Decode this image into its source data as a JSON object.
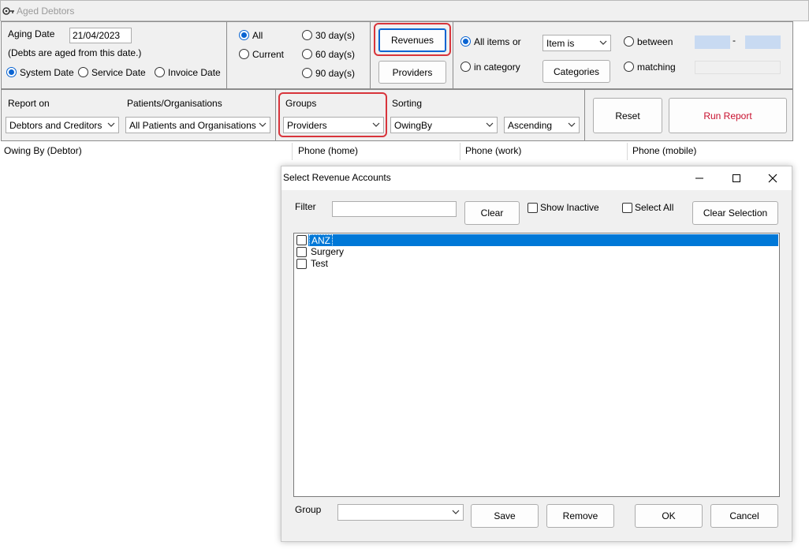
{
  "window": {
    "title": "Aged Debtors"
  },
  "aging": {
    "label": "Aging Date",
    "date": "21/04/2023",
    "note": "(Debts are aged from this date.)",
    "date_modes": [
      "System Date",
      "Service Date",
      "Invoice Date"
    ],
    "selected_mode": "System Date"
  },
  "period": {
    "options": [
      "All",
      "Current",
      "30 day(s)",
      "60 day(s)",
      "90 day(s)"
    ],
    "selected": "All"
  },
  "buttons": {
    "revenues": "Revenues",
    "providers": "Providers",
    "categories": "Categories",
    "reset": "Reset",
    "run_report": "Run Report"
  },
  "items": {
    "all_items": "All items",
    "or": "or",
    "in_category": "in category",
    "item_is": "Item is",
    "between": "between",
    "dash": "-",
    "matching": "matching"
  },
  "report": {
    "report_on_label": "Report on",
    "report_on_value": "Debtors and Creditors",
    "patients_label": "Patients/Organisations",
    "patients_value": "All Patients and Organisations",
    "groups_label": "Groups",
    "groups_value": "Providers",
    "sorting_label": "Sorting",
    "sorting_value": "OwingBy",
    "order_value": "Ascending"
  },
  "table": {
    "columns": [
      "Owing By (Debtor)",
      "Phone (home)",
      "Phone (work)",
      "Phone (mobile)"
    ]
  },
  "dialog": {
    "title": "Select Revenue Accounts",
    "filter_label": "Filter",
    "filter_value": "",
    "clear": "Clear",
    "show_inactive": "Show Inactive",
    "select_all": "Select All",
    "clear_selection": "Clear Selection",
    "accounts": [
      "ANZ",
      "Surgery",
      "Test"
    ],
    "selected_account": "ANZ",
    "group_label": "Group",
    "group_value": "",
    "save": "Save",
    "remove": "Remove",
    "ok": "OK",
    "cancel": "Cancel"
  },
  "colors": {
    "accent": "#0a64d2",
    "highlight": "#d8343b",
    "selection": "#0078d7",
    "run_report": "#c8102e"
  }
}
